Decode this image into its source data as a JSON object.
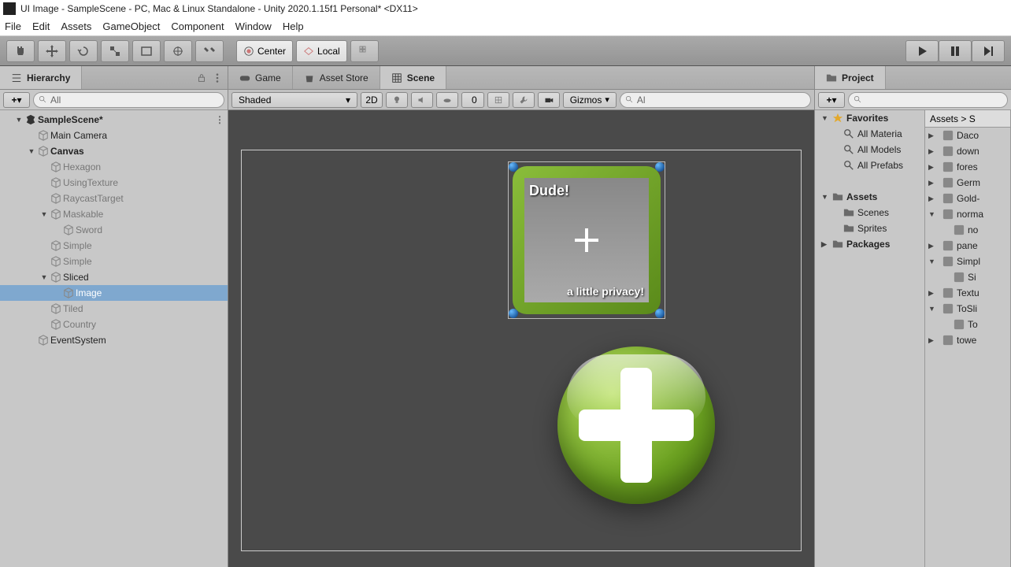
{
  "window": {
    "title": "UI Image - SampleScene - PC, Mac & Linux Standalone - Unity 2020.1.15f1 Personal* <DX11>"
  },
  "menu": {
    "items": [
      "File",
      "Edit",
      "Assets",
      "GameObject",
      "Component",
      "Window",
      "Help"
    ]
  },
  "toolbar": {
    "center": "Center",
    "local": "Local"
  },
  "hierarchy": {
    "tab": "Hierarchy",
    "search": "All",
    "items": [
      {
        "label": "SampleScene*",
        "depth": 0,
        "bold": true,
        "exp": true,
        "icon": "unity"
      },
      {
        "label": "Main Camera",
        "depth": 1,
        "icon": "cube"
      },
      {
        "label": "Canvas",
        "depth": 1,
        "bold": true,
        "exp": true,
        "icon": "cube"
      },
      {
        "label": "Hexagon",
        "depth": 2,
        "icon": "cube",
        "gray": true
      },
      {
        "label": "UsingTexture",
        "depth": 2,
        "icon": "cube",
        "gray": true
      },
      {
        "label": "RaycastTarget",
        "depth": 2,
        "icon": "cube",
        "gray": true
      },
      {
        "label": "Maskable",
        "depth": 2,
        "icon": "cube",
        "exp": true,
        "gray": true
      },
      {
        "label": "Sword",
        "depth": 3,
        "icon": "cube",
        "gray": true
      },
      {
        "label": "Simple",
        "depth": 2,
        "icon": "cube",
        "gray": true
      },
      {
        "label": "Simple",
        "depth": 2,
        "icon": "cube",
        "gray": true
      },
      {
        "label": "Sliced",
        "depth": 2,
        "icon": "cube",
        "exp": true
      },
      {
        "label": "Image",
        "depth": 3,
        "icon": "cube",
        "sel": true
      },
      {
        "label": "Tiled",
        "depth": 2,
        "icon": "cube",
        "gray": true
      },
      {
        "label": "Country",
        "depth": 2,
        "icon": "cube",
        "gray": true
      },
      {
        "label": "EventSystem",
        "depth": 1,
        "icon": "cube"
      }
    ]
  },
  "scene": {
    "tabs": {
      "game": "Game",
      "asset": "Asset Store",
      "scene": "Scene"
    },
    "shading": "Shaded",
    "twod": "2D",
    "hidden": "0",
    "gizmos": "Gizmos",
    "search": "Al",
    "image_text1": "Dude!",
    "image_text2": "a little privacy!"
  },
  "project": {
    "tab": "Project",
    "search": "",
    "breadcrumb": "Assets > S",
    "col1": [
      {
        "label": "Favorites",
        "bold": true,
        "icon": "star",
        "exp": true
      },
      {
        "label": "All Materia",
        "icon": "search",
        "indent": 1
      },
      {
        "label": "All Models",
        "icon": "search",
        "indent": 1
      },
      {
        "label": "All Prefabs",
        "icon": "search",
        "indent": 1
      },
      {
        "label": "",
        "blank": true
      },
      {
        "label": "Assets",
        "bold": true,
        "icon": "folder",
        "exp": true
      },
      {
        "label": "Scenes",
        "icon": "folder",
        "indent": 1
      },
      {
        "label": "Sprites",
        "icon": "folder",
        "indent": 1
      },
      {
        "label": "Packages",
        "bold": true,
        "icon": "folder",
        "exp": false
      }
    ],
    "col2": [
      {
        "label": "Daco",
        "exp": false
      },
      {
        "label": "down",
        "exp": false
      },
      {
        "label": "fores",
        "exp": false
      },
      {
        "label": "Germ",
        "exp": false
      },
      {
        "label": "Gold-",
        "exp": false
      },
      {
        "label": "norma",
        "exp": true
      },
      {
        "label": "no",
        "indent": 1
      },
      {
        "label": "pane",
        "exp": false
      },
      {
        "label": "Simpl",
        "exp": true
      },
      {
        "label": "Si",
        "indent": 1
      },
      {
        "label": "Textu",
        "exp": false
      },
      {
        "label": "ToSli",
        "exp": true
      },
      {
        "label": "To",
        "indent": 1
      },
      {
        "label": "towe",
        "exp": false
      }
    ]
  }
}
